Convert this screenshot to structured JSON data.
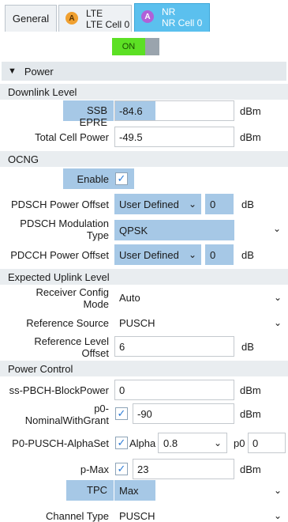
{
  "tabs": {
    "general": "General",
    "lte": {
      "badge": "A",
      "line1": "LTE",
      "line2": "LTE Cell 0"
    },
    "nr": {
      "badge": "A",
      "line1": "NR",
      "line2": "NR Cell 0"
    }
  },
  "toggle": {
    "label": "ON"
  },
  "power_section": {
    "title": "Power"
  },
  "downlink": {
    "title": "Downlink Level",
    "ssb_label": "SSB EPRE",
    "ssb_value": "-84.6",
    "ssb_unit": "dBm",
    "total_label": "Total Cell Power",
    "total_value": "-49.5",
    "total_unit": "dBm"
  },
  "ocng": {
    "title": "OCNG",
    "enable_label": "Enable",
    "pdsch_offset_label": "PDSCH Power Offset",
    "pdsch_offset_mode": "User Defined",
    "pdsch_offset_value": "0",
    "pdsch_offset_unit": "dB",
    "pdsch_mod_label1": "PDSCH Modulation",
    "pdsch_mod_label2": "Type",
    "pdsch_mod_value": "QPSK",
    "pdcch_offset_label": "PDCCH Power Offset",
    "pdcch_offset_mode": "User Defined",
    "pdcch_offset_value": "0",
    "pdcch_offset_unit": "dB"
  },
  "uplink": {
    "title": "Expected Uplink Level",
    "rcv_label1": "Receiver Config",
    "rcv_label2": "Mode",
    "rcv_value": "Auto",
    "ref_src_label": "Reference Source",
    "ref_src_value": "PUSCH",
    "ref_lvl_label1": "Reference Level",
    "ref_lvl_label2": "Offset",
    "ref_lvl_value": "6",
    "ref_lvl_unit": "dB"
  },
  "power_control": {
    "title": "Power Control",
    "ssbpch_label": "ss-PBCH-BlockPower",
    "ssbpch_value": "0",
    "ssbpch_unit": "dBm",
    "p0_label1": "p0-",
    "p0_label2": "NominalWithGrant",
    "p0_value": "-90",
    "p0_unit": "dBm",
    "alpha_label": "P0-PUSCH-AlphaSet",
    "alpha_text": "Alpha",
    "alpha_value": "0.8",
    "p0_text": "p0",
    "p0_small_value": "0",
    "pmax_label": "p-Max",
    "pmax_value": "23",
    "pmax_unit": "dBm",
    "tpc_label": "TPC",
    "tpc_value": "Max",
    "channel_label": "Channel Type",
    "channel_value": "PUSCH"
  },
  "icons": {
    "dropdown": "chevron-down-icon",
    "check": "checkmark-icon",
    "collapse": "triangle-down-icon"
  }
}
